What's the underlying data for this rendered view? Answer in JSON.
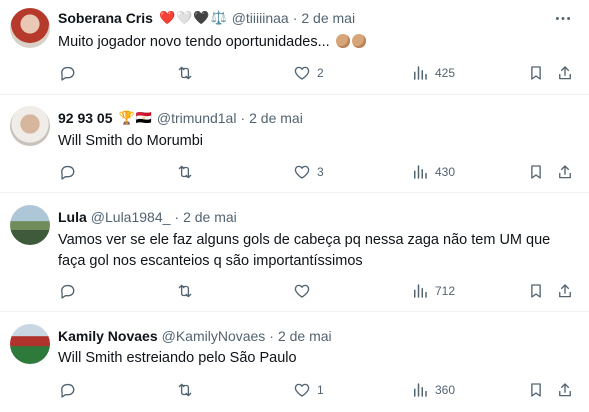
{
  "tweets": [
    {
      "name": "Soberana Cris",
      "emoji": "❤️🤍🖤⚖️",
      "handle": "@tiiiiinaa",
      "dot": "·",
      "time": "2 de mai",
      "text": "Muito jogador novo tendo oportunidades...",
      "likes": "2",
      "views": "425"
    },
    {
      "name": "92 93 05",
      "emoji": "🏆🇪🇬",
      "handle": "@trimund1al",
      "dot": "·",
      "time": "2 de mai",
      "text": "Will Smith do Morumbi",
      "likes": "3",
      "views": "430"
    },
    {
      "name": "Lula",
      "handle": "@Lula1984_",
      "dot": "·",
      "time": "2 de mai",
      "text": "Vamos ver se ele faz alguns gols de cabeça pq nessa zaga não tem UM que faça gol nos escanteios q são importantíssimos",
      "likes": "",
      "views": "712"
    },
    {
      "name": "Kamily Novaes",
      "handle": "@KamilyNovaes",
      "dot": "·",
      "time": "2 de mai",
      "text": "Will Smith estreiando pelo São Paulo",
      "likes": "1",
      "views": "360"
    }
  ],
  "icons": {
    "reply": "reply-icon",
    "retweet": "retweet-icon",
    "like": "like-icon",
    "views": "views-icon",
    "bookmark": "bookmark-icon",
    "share": "share-icon",
    "more": "more-icon"
  },
  "colors": {
    "text": "#0f1419",
    "secondary": "#536471",
    "divider": "#eff3f4"
  }
}
